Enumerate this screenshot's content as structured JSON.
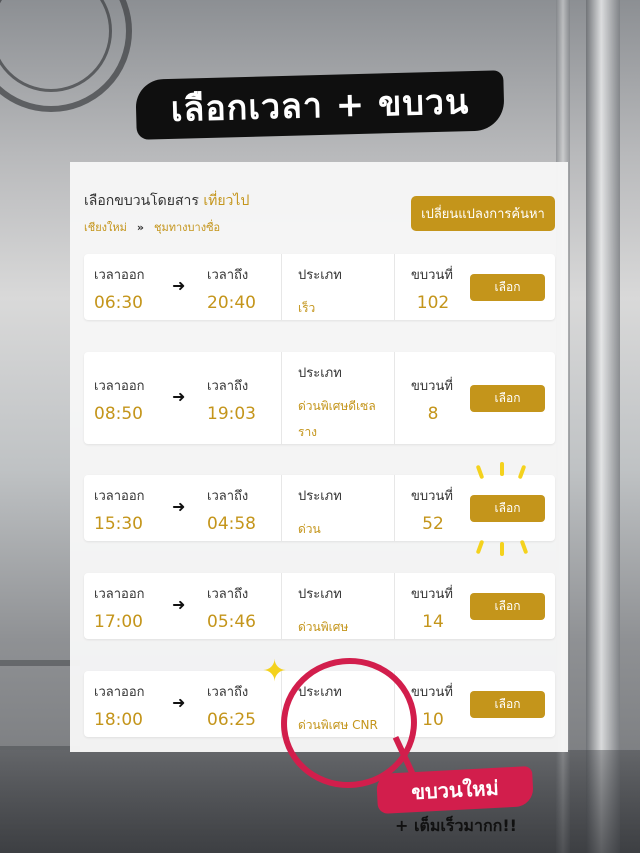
{
  "title": "เลือกเวลา + ขบวน",
  "search": {
    "heading": "เลือกขบวนโดยสาร",
    "trip_type": "เที่ยวไป",
    "origin": "เชียงใหม่",
    "route_arrow": "»",
    "destination": "ชุมทางบางซื่อ",
    "change_button": "เปลี่ยนแปลงการค้นหา"
  },
  "labels": {
    "depart": "เวลาออก",
    "arrive": "เวลาถึง",
    "type": "ประเภท",
    "train_no": "ขบวนที่",
    "select": "เลือก",
    "arrow": "➜"
  },
  "trains": [
    {
      "depart": "06:30",
      "arrive": "20:40",
      "type": "เร็ว",
      "number": "102"
    },
    {
      "depart": "08:50",
      "arrive": "19:03",
      "type": "ด่วนพิเศษดีเซลราง",
      "number": "8"
    },
    {
      "depart": "15:30",
      "arrive": "04:58",
      "type": "ด่วน",
      "number": "52"
    },
    {
      "depart": "17:00",
      "arrive": "05:46",
      "type": "ด่วนพิเศษ",
      "number": "14"
    },
    {
      "depart": "18:00",
      "arrive": "06:25",
      "type": "ด่วนพิเศษ CNR",
      "number": "10"
    }
  ],
  "annotation": {
    "new_badge": "ขบวนใหม่",
    "note": "+ เต็มเร็วมากก!!",
    "sparkle_icon": "sparkle-icon",
    "circle_color": "#d21e4c"
  },
  "colors": {
    "accent": "#c4951b",
    "highlight": "#d21e4c",
    "sparkle": "#f4d21d"
  }
}
